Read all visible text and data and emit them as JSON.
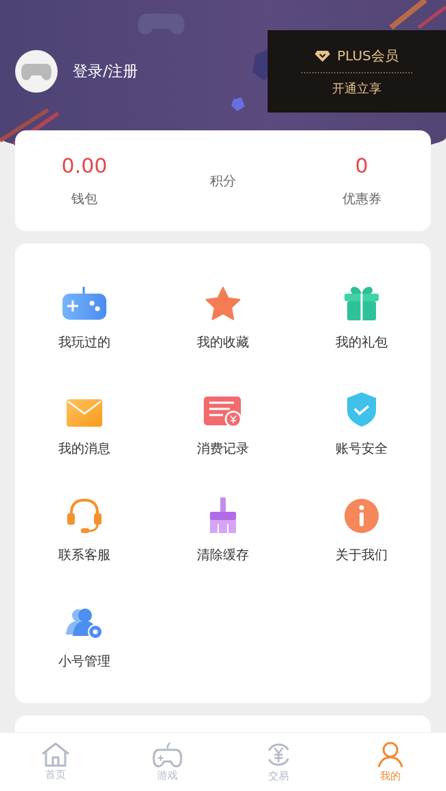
{
  "profile": {
    "login_label": "登录/注册"
  },
  "plus": {
    "title": "PLUS会员",
    "action": "开通立享"
  },
  "stats": [
    {
      "value": "0.00",
      "label": "钱包"
    },
    {
      "label": "积分"
    },
    {
      "value": "0",
      "label": "优惠券"
    }
  ],
  "menu": [
    {
      "kind": "gamepad",
      "label": "我玩过的"
    },
    {
      "kind": "star",
      "label": "我的收藏"
    },
    {
      "kind": "gift",
      "label": "我的礼包"
    },
    {
      "kind": "mail",
      "label": "我的消息"
    },
    {
      "kind": "bill",
      "label": "消费记录"
    },
    {
      "kind": "shield",
      "label": "账号安全"
    },
    {
      "kind": "headset",
      "label": "联系客服"
    },
    {
      "kind": "broom",
      "label": "清除缓存"
    },
    {
      "kind": "info",
      "label": "关于我们"
    },
    {
      "kind": "users",
      "label": "小号管理"
    }
  ],
  "tabbar": [
    {
      "kind": "home",
      "label": "首页",
      "selected": false
    },
    {
      "kind": "game",
      "label": "游戏",
      "selected": false
    },
    {
      "kind": "trade",
      "label": "交易",
      "selected": false
    },
    {
      "kind": "me",
      "label": "我的",
      "selected": true
    }
  ]
}
